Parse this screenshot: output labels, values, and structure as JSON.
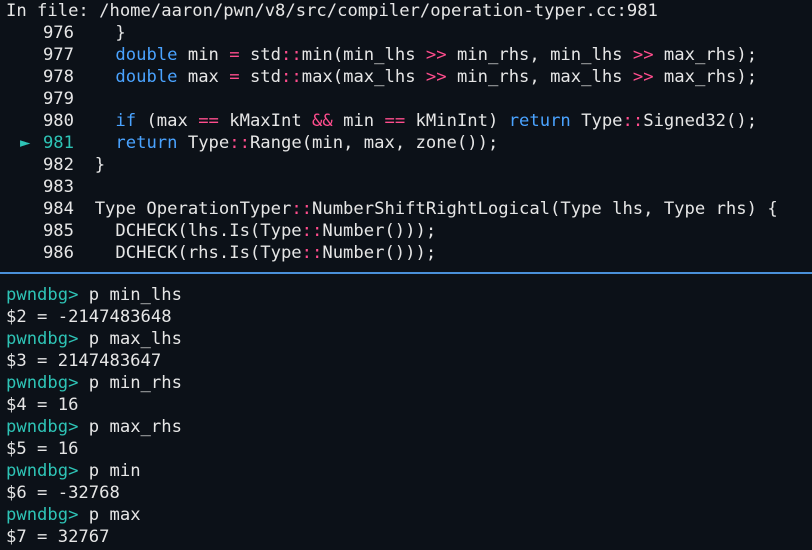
{
  "source": {
    "header": "In file: /home/aaron/pwn/v8/src/compiler/operation-typer.cc:981",
    "current_line": "981",
    "current_marker": "►",
    "lines": [
      {
        "no": "976",
        "tokens": [
          {
            "t": "    }",
            "c": ""
          }
        ]
      },
      {
        "no": "977",
        "tokens": [
          {
            "t": "    ",
            "c": ""
          },
          {
            "t": "double",
            "c": "kw"
          },
          {
            "t": " min ",
            "c": ""
          },
          {
            "t": "=",
            "c": "op"
          },
          {
            "t": " std",
            "c": ""
          },
          {
            "t": "::",
            "c": "ns"
          },
          {
            "t": "min(min_lhs ",
            "c": ""
          },
          {
            "t": ">>",
            "c": "op"
          },
          {
            "t": " min_rhs, min_lhs ",
            "c": ""
          },
          {
            "t": ">>",
            "c": "op"
          },
          {
            "t": " max_rhs);",
            "c": ""
          }
        ]
      },
      {
        "no": "978",
        "tokens": [
          {
            "t": "    ",
            "c": ""
          },
          {
            "t": "double",
            "c": "kw"
          },
          {
            "t": " max ",
            "c": ""
          },
          {
            "t": "=",
            "c": "op"
          },
          {
            "t": " std",
            "c": ""
          },
          {
            "t": "::",
            "c": "ns"
          },
          {
            "t": "max(max_lhs ",
            "c": ""
          },
          {
            "t": ">>",
            "c": "op"
          },
          {
            "t": " min_rhs, max_lhs ",
            "c": ""
          },
          {
            "t": ">>",
            "c": "op"
          },
          {
            "t": " max_rhs);",
            "c": ""
          }
        ]
      },
      {
        "no": "979",
        "tokens": []
      },
      {
        "no": "980",
        "tokens": [
          {
            "t": "    ",
            "c": ""
          },
          {
            "t": "if",
            "c": "kw"
          },
          {
            "t": " (max ",
            "c": ""
          },
          {
            "t": "==",
            "c": "op"
          },
          {
            "t": " kMaxInt ",
            "c": ""
          },
          {
            "t": "&&",
            "c": "op"
          },
          {
            "t": " min ",
            "c": ""
          },
          {
            "t": "==",
            "c": "op"
          },
          {
            "t": " kMinInt) ",
            "c": ""
          },
          {
            "t": "return",
            "c": "kw"
          },
          {
            "t": " Type",
            "c": ""
          },
          {
            "t": "::",
            "c": "ns"
          },
          {
            "t": "Signed32();",
            "c": ""
          }
        ]
      },
      {
        "no": "981",
        "tokens": [
          {
            "t": "    ",
            "c": ""
          },
          {
            "t": "return",
            "c": "kw"
          },
          {
            "t": " Type",
            "c": ""
          },
          {
            "t": "::",
            "c": "ns"
          },
          {
            "t": "Range(min, max, zone());",
            "c": ""
          }
        ]
      },
      {
        "no": "982",
        "tokens": [
          {
            "t": "  }",
            "c": ""
          }
        ]
      },
      {
        "no": "983",
        "tokens": []
      },
      {
        "no": "984",
        "tokens": [
          {
            "t": "  Type OperationTyper",
            "c": ""
          },
          {
            "t": "::",
            "c": "ns"
          },
          {
            "t": "NumberShiftRightLogical(Type lhs, Type rhs) {",
            "c": ""
          }
        ]
      },
      {
        "no": "985",
        "tokens": [
          {
            "t": "    DCHECK(lhs.Is(Type",
            "c": ""
          },
          {
            "t": "::",
            "c": "ns"
          },
          {
            "t": "Number()));",
            "c": ""
          }
        ]
      },
      {
        "no": "986",
        "tokens": [
          {
            "t": "    DCHECK(rhs.Is(Type",
            "c": ""
          },
          {
            "t": "::",
            "c": "ns"
          },
          {
            "t": "Number()));",
            "c": ""
          }
        ]
      }
    ]
  },
  "gdb": {
    "prompt": "pwndbg>",
    "entries": [
      {
        "cmd": "p min_lhs",
        "out": "$2 = -2147483648"
      },
      {
        "cmd": "p max_lhs",
        "out": "$3 = 2147483647"
      },
      {
        "cmd": "p min_rhs",
        "out": "$4 = 16"
      },
      {
        "cmd": "p max_rhs",
        "out": "$5 = 16"
      },
      {
        "cmd": "p min",
        "out": "$6 = -32768"
      },
      {
        "cmd": "p max",
        "out": "$7 = 32767"
      }
    ]
  },
  "colors": {
    "background": "#0c1118",
    "keyword": "#4aa3ff",
    "operator": "#ff4d8d",
    "prompt": "#2ec4b6",
    "separator": "#4a90d9"
  }
}
